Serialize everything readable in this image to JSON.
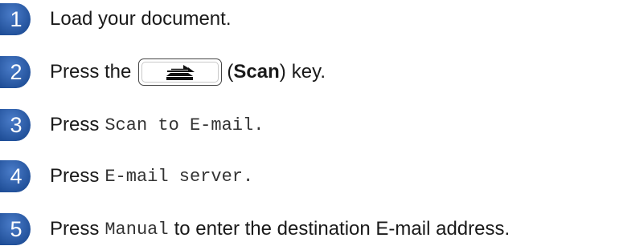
{
  "steps": [
    {
      "number": "1",
      "text": "Load your document."
    },
    {
      "number": "2",
      "prefix": "Press the",
      "key_name": "(Scan)",
      "key_name_open": "(",
      "key_name_bold": "Scan",
      "key_name_close": ")",
      "suffix": "key.",
      "key_icon": "scan-key-icon"
    },
    {
      "number": "3",
      "prefix": "Press",
      "mono": "Scan to E-mail",
      "suffix": "."
    },
    {
      "number": "4",
      "prefix": "Press",
      "mono": "E-mail server",
      "suffix": "."
    },
    {
      "number": "5",
      "prefix": "Press",
      "mono": "Manual",
      "suffix": "to enter the destination E-mail address."
    }
  ],
  "colors": {
    "badge": "#1f4e97",
    "badge_highlight": "#4a7cc9",
    "text": "#1a1a1a"
  }
}
